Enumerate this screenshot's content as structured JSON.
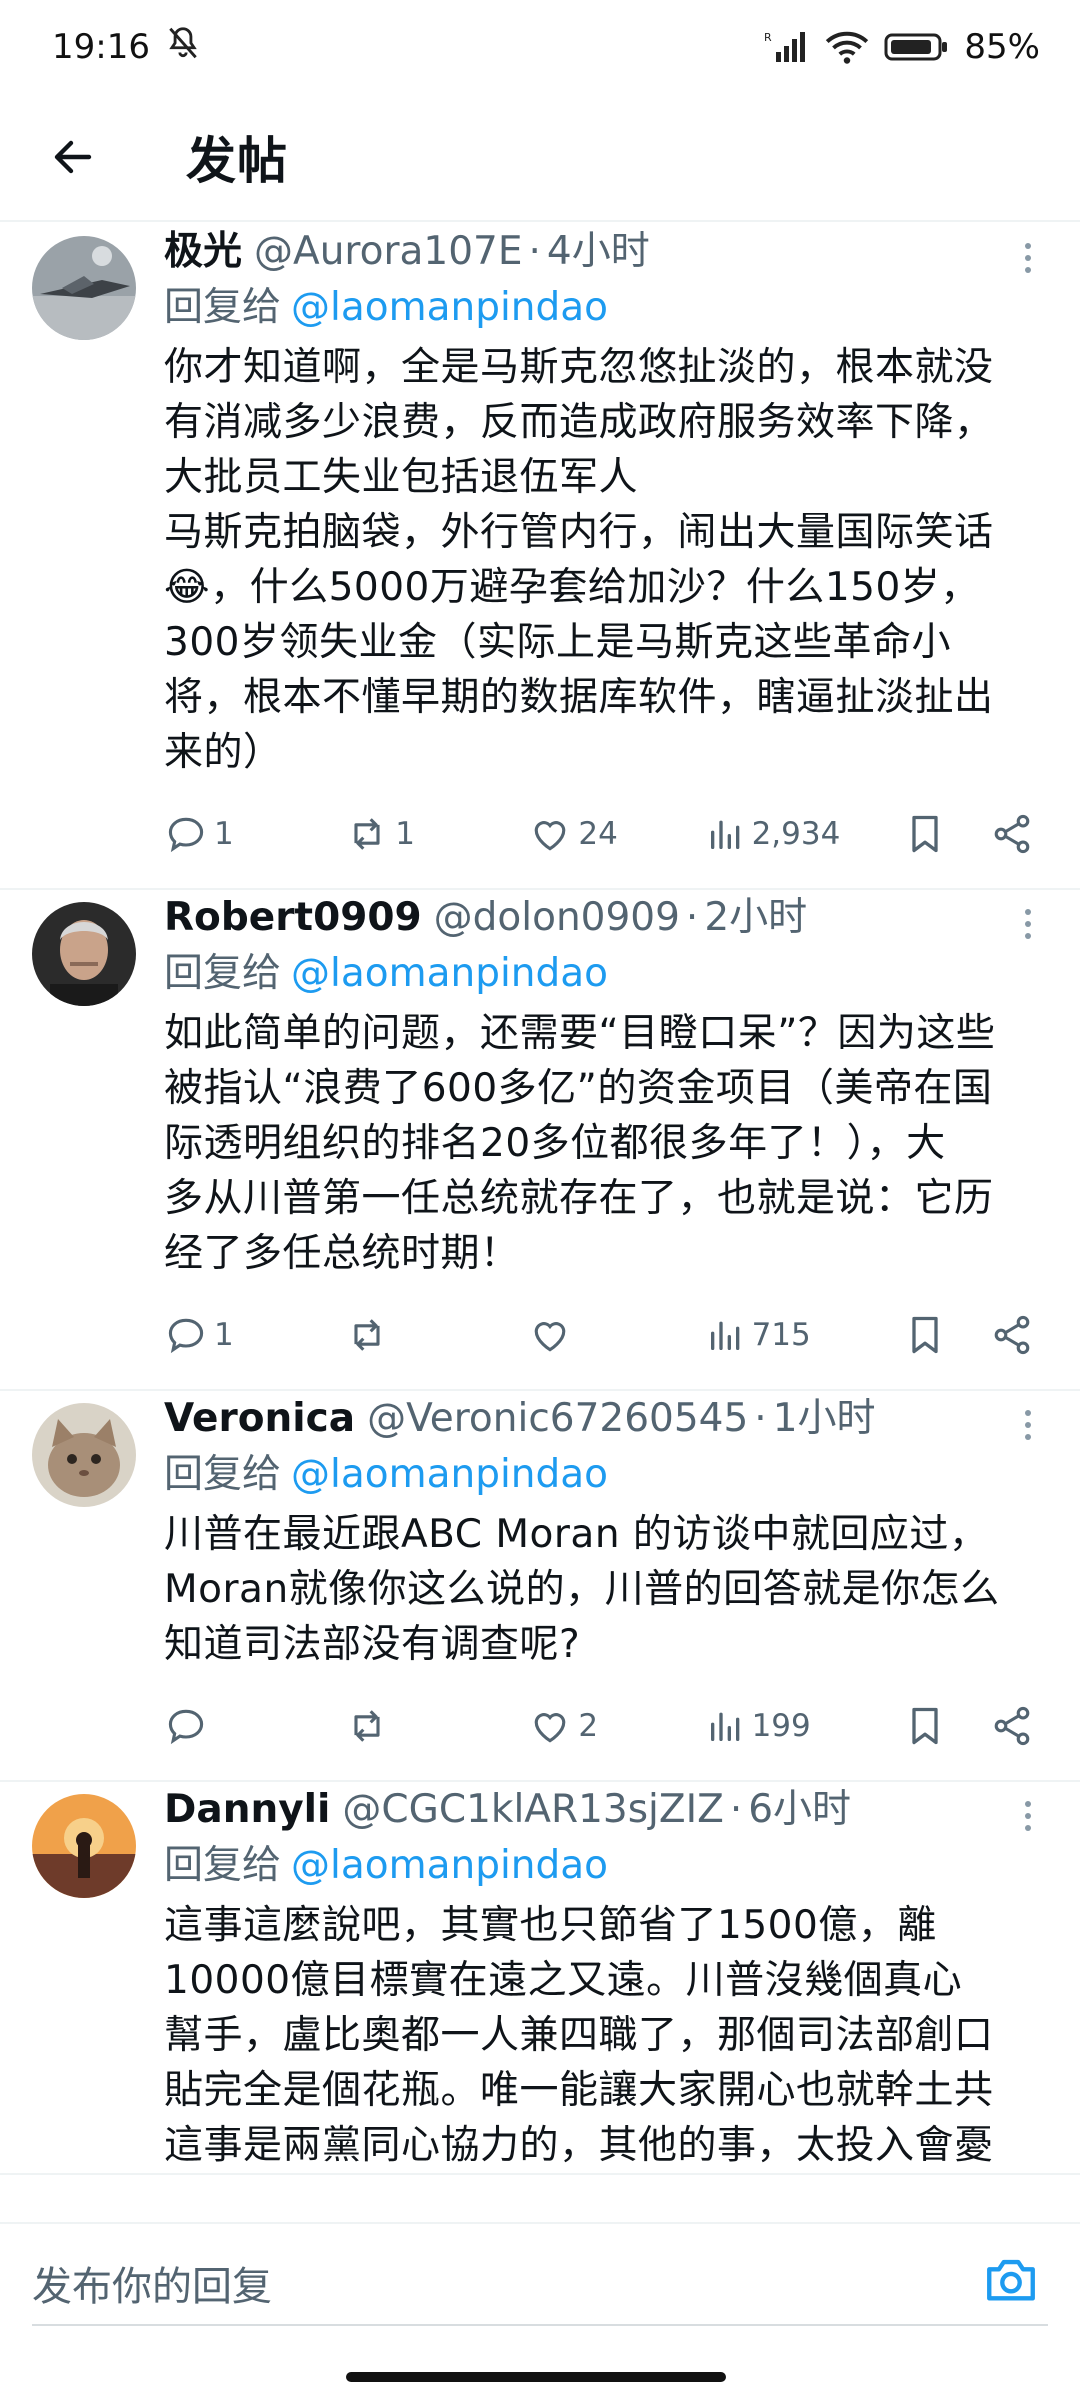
{
  "status_bar": {
    "time": "19:16",
    "battery": "85%",
    "signal_label": "R"
  },
  "header": {
    "title": "发帖"
  },
  "reply_prefix": "回复给",
  "posts": [
    {
      "name": "极光",
      "handle": "@Aurora107E",
      "time": "4小时",
      "reply_to": "@laomanpindao",
      "text_lines": [
        "你才知道啊，全是马斯克忽悠扯淡的，根本就没",
        "有消减多少浪费，反而造成政府服务效率下降，",
        "大批员工失业包括退伍军人",
        "马斯克拍脑袋，外行管内行，闹出大量国际笑话",
        "😂，什么5000万避孕套给加沙？什么150岁，",
        "300岁领失业金（实际上是马斯克这些革命小",
        "将，根本不懂早期的数据库软件，瞎逼扯淡扯出",
        "来的）"
      ],
      "replies": "1",
      "retweets": "1",
      "likes": "24",
      "views": "2,934"
    },
    {
      "name": "Robert0909",
      "handle": "@dolon0909",
      "time": "2小时",
      "reply_to": "@laomanpindao",
      "text_lines": [
        "如此简单的问题，还需要“目瞪口呆”？因为这些",
        "被指认“浪费了600多亿”的资金项目（美帝在国",
        "际透明组织的排名20多位都很多年了！），大",
        "多从川普第一任总统就存在了，也就是说：它历",
        "经了多任总统时期！"
      ],
      "replies": "1",
      "retweets": "",
      "likes": "",
      "views": "715"
    },
    {
      "name": "Veronica",
      "handle": "@Veronic67260545",
      "time": "1小时",
      "reply_to": "@laomanpindao",
      "text_lines": [
        "川普在最近跟ABC Moran 的访谈中就回应过，",
        "Moran就像你这么说的，川普的回答就是你怎么",
        "知道司法部没有调查呢?"
      ],
      "replies": "",
      "retweets": "",
      "likes": "2",
      "views": "199"
    },
    {
      "name": "Dannyli",
      "handle": "@CGC1klAR13sjZIZ",
      "time": "6小时",
      "reply_to": "@laomanpindao",
      "text_lines": [
        "這事這麼說吧，其實也只節省了1500億，離",
        "10000億目標實在遠之又遠。川普沒幾個真心",
        "幫手，盧比奧都一人兼四職了，那個司法部創口",
        "貼完全是個花瓶。唯一能讓大家開心也就幹土共",
        "這事是兩黨同心協力的，其他的事，太投入會憂"
      ],
      "replies": "",
      "retweets": "",
      "likes": "",
      "views": ""
    }
  ],
  "composer": {
    "placeholder": "发布你的回复"
  },
  "colors": {
    "accent": "#1d9bf0",
    "secondary_text": "#536471",
    "divider": "#eff3f4"
  }
}
